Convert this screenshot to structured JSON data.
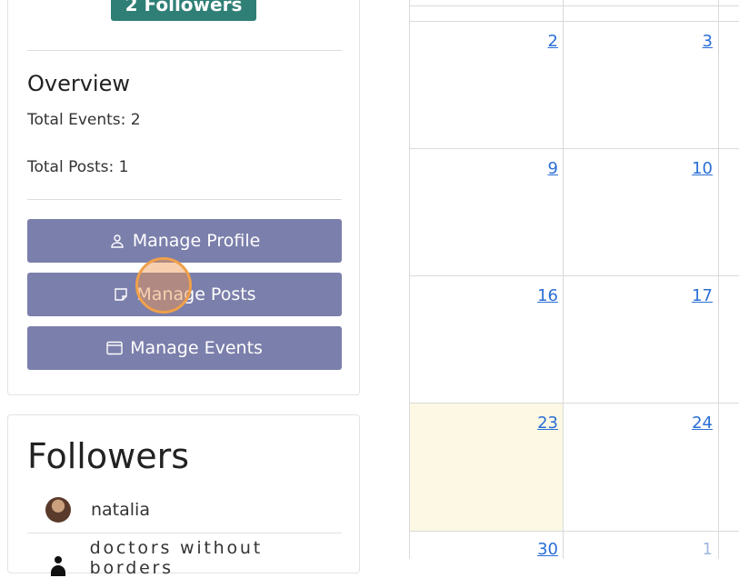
{
  "profile": {
    "followers_badge": "2 Followers"
  },
  "overview": {
    "title": "Overview",
    "total_events": "Total Events: 2",
    "total_posts": "Total Posts: 1"
  },
  "actions": {
    "manage_profile": "Manage Profile",
    "manage_posts": "Manage Posts",
    "manage_events": "Manage Events"
  },
  "followers": {
    "title": "Followers",
    "items": [
      {
        "name": "natalia",
        "icon": "photo-avatar"
      },
      {
        "name": "doctors without borders",
        "icon": "person-icon"
      }
    ]
  },
  "calendar": {
    "highlight_color": "#fcf8e3",
    "link_color": "#2a6fd6",
    "days": [
      {
        "label": "2"
      },
      {
        "label": "3"
      },
      {
        "label": "9"
      },
      {
        "label": "10"
      },
      {
        "label": "16"
      },
      {
        "label": "17"
      },
      {
        "label": "23"
      },
      {
        "label": "24"
      },
      {
        "label": "30"
      },
      {
        "label": "1"
      }
    ]
  },
  "colors": {
    "badge": "#2f7f76",
    "button": "#7b7fab"
  }
}
